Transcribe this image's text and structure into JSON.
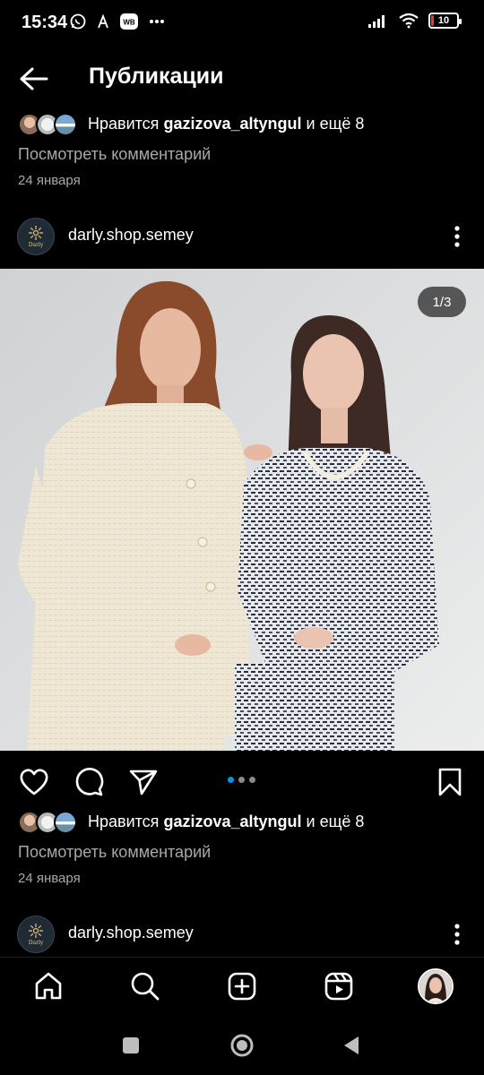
{
  "status_bar": {
    "time": "15:34",
    "battery": "10",
    "battery_level": 0.1,
    "battery_color": "#e53935"
  },
  "header": {
    "title": "Публикации",
    "back_icon": "arrow-left-icon"
  },
  "likes_top": {
    "prefix": "Нравится",
    "user": "gazizova_altyngul",
    "suffix": "и ещё 8"
  },
  "comments_top": {
    "label": "Посмотреть комментарий",
    "date": "24 января"
  },
  "post": {
    "username": "darly.shop.semey",
    "avatar_logo": "Darly",
    "image_counter": "1/3",
    "carousel_total": 3,
    "carousel_active": 1,
    "accent": "#0095f6"
  },
  "likes_bottom": {
    "prefix": "Нравится",
    "user": "gazizova_altyngul",
    "suffix": "и ещё 8"
  },
  "comments_bottom": {
    "label": "Посмотреть комментарий",
    "date": "24 января"
  },
  "next_post": {
    "username": "darly.shop.semey",
    "avatar_logo": "Darly"
  },
  "nav": {
    "items": [
      "home-icon",
      "search-icon",
      "create-icon",
      "reels-icon",
      "profile-avatar"
    ]
  },
  "system_nav": {
    "items": [
      "recents-icon",
      "home-circle-icon",
      "back-triangle-icon"
    ]
  }
}
